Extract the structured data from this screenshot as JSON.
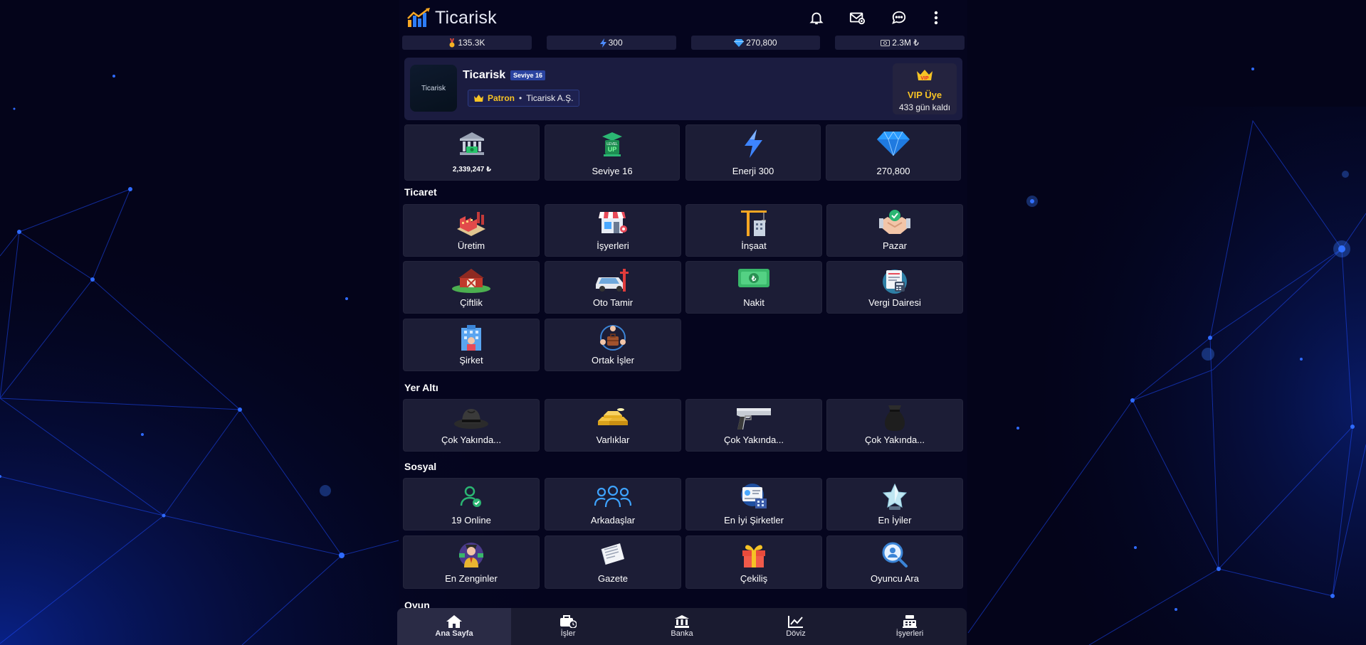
{
  "app": {
    "name": "Ticarisk"
  },
  "header": {
    "icons": [
      "bell-icon",
      "mail-icon",
      "chat-icon",
      "more-vertical-icon"
    ]
  },
  "stats": [
    {
      "icon": "medal-icon",
      "value": "135.3K"
    },
    {
      "icon": "lightning-icon",
      "value": "300"
    },
    {
      "icon": "diamond-icon",
      "value": "270,800"
    },
    {
      "icon": "cash-icon",
      "value": "2.3M ₺"
    }
  ],
  "profile": {
    "name": "Ticarisk",
    "level_badge": "Seviye 16",
    "avatar_text": "Ticarisk",
    "role": "Patron",
    "separator": "•",
    "company": "Ticarisk A.Ş.",
    "vip_badge": "VIP",
    "vip_label": "VIP Üye",
    "vip_days": "433 gün kaldı"
  },
  "summary": [
    {
      "icon": "bank-icon",
      "label": "2,339,247 ₺"
    },
    {
      "icon": "level-up-icon",
      "label": "Seviye 16",
      "icon_text": "LEVEL UP"
    },
    {
      "icon": "lightning-icon",
      "label": "Enerji 300"
    },
    {
      "icon": "diamond-icon",
      "label": "270,800"
    }
  ],
  "sections": {
    "ticaret": {
      "title": "Ticaret",
      "items": [
        {
          "icon": "factory-icon",
          "label": "Üretim"
        },
        {
          "icon": "store-icon",
          "label": "İşyerleri"
        },
        {
          "icon": "crane-icon",
          "label": "İnşaat"
        },
        {
          "icon": "handshake-icon",
          "label": "Pazar"
        },
        {
          "icon": "barn-icon",
          "label": "Çiftlik"
        },
        {
          "icon": "car-repair-icon",
          "label": "Oto Tamir"
        },
        {
          "icon": "cash-icon",
          "label": "Nakit"
        },
        {
          "icon": "tax-office-icon",
          "label": "Vergi Dairesi"
        },
        {
          "icon": "office-building-icon",
          "label": "Şirket"
        },
        {
          "icon": "partners-icon",
          "label": "Ortak İşler"
        }
      ]
    },
    "yeralti": {
      "title": "Yer Altı",
      "items": [
        {
          "icon": "fedora-hat-icon",
          "label": "Çok Yakında..."
        },
        {
          "icon": "gold-bars-icon",
          "label": "Varlıklar"
        },
        {
          "icon": "pistol-icon",
          "label": "Çok Yakında..."
        },
        {
          "icon": "money-bag-icon",
          "label": "Çok Yakında..."
        }
      ]
    },
    "sosyal": {
      "title": "Sosyal",
      "items": [
        {
          "icon": "user-online-icon",
          "label": "19 Online"
        },
        {
          "icon": "friends-icon",
          "label": "Arkadaşlar"
        },
        {
          "icon": "companies-icon",
          "label": "En İyi Şirketler"
        },
        {
          "icon": "star-trophy-icon",
          "label": "En İyiler"
        },
        {
          "icon": "rich-man-icon",
          "label": "En Zenginler"
        },
        {
          "icon": "newspaper-icon",
          "label": "Gazete"
        },
        {
          "icon": "gift-icon",
          "label": "Çekiliş"
        },
        {
          "icon": "user-search-icon",
          "label": "Oyuncu Ara"
        }
      ]
    },
    "oyun": {
      "title": "Oyun"
    }
  },
  "bottom_nav": [
    {
      "icon": "home-icon",
      "label": "Ana Sayfa",
      "active": true
    },
    {
      "icon": "briefcase-icon",
      "label": "İşler"
    },
    {
      "icon": "bank-icon",
      "label": "Banka"
    },
    {
      "icon": "chart-line-icon",
      "label": "Döviz"
    },
    {
      "icon": "cash-register-icon",
      "label": "İşyerleri"
    }
  ],
  "colors": {
    "background": "#04041a",
    "tile": "#1c1d36",
    "gold": "#f6c325",
    "accent_blue": "#2a43a0"
  }
}
